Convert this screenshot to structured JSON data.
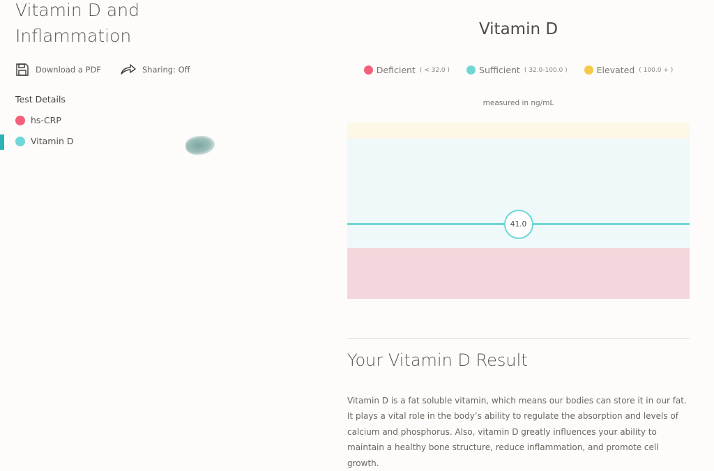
{
  "page_title": "Vitamin D and Inflammation",
  "actions": {
    "download_label": "Download a PDF",
    "sharing_label": "Sharing: Off"
  },
  "sidebar": {
    "section_title": "Test Details",
    "items": [
      {
        "label": "hs-CRP",
        "color": "#f2617a",
        "active": false
      },
      {
        "label": "Vitamin D",
        "color": "#6fd7d5",
        "active": true
      }
    ]
  },
  "chart": {
    "title": "Vitamin D",
    "legend": [
      {
        "label": "Deficient",
        "range": "( < 32.0 )",
        "color": "#f2617a"
      },
      {
        "label": "Sufficient",
        "range": "( 32.0-100.0 )",
        "color": "#6fd7d5"
      },
      {
        "label": "Elevated",
        "range": "( 100.0 + )",
        "color": "#f7c948"
      }
    ],
    "units": "measured in ng/mL",
    "value": 41.0,
    "value_label": "41.0",
    "ranges": {
      "deficient_max": 32.0,
      "sufficient_max": 100.0
    },
    "band_colors": {
      "deficient": "#f4d7dc",
      "sufficient": "#eff9fa",
      "elevated": "#fcf7e7"
    },
    "marker_color": "#6fd7d5"
  },
  "result": {
    "heading": "Your Vitamin D Result",
    "body": "Vitamin D is a fat soluble vitamin, which means our bodies can store it in our fat. It plays a vital role in the body’s ability to regulate the absorption and levels of calcium and phosphorus. Also, vitamin D greatly influences your ability to maintain a healthy bone structure, reduce inflammation, and promote cell growth."
  }
}
